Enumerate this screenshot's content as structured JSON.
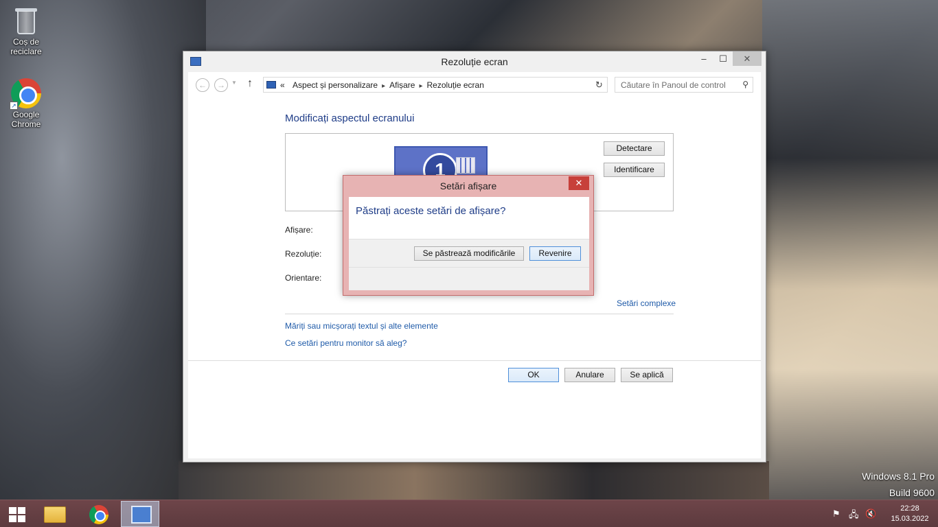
{
  "desktop": {
    "icons": [
      {
        "label": "Coș de reciclare",
        "icon": "recycle-bin-icon"
      },
      {
        "label": "Google Chrome",
        "icon": "chrome-icon"
      }
    ]
  },
  "window": {
    "title": "Rezoluție ecran",
    "controls": {
      "minimize": "–",
      "maximize": "☐",
      "close": "✕"
    },
    "address": {
      "prefix": "«",
      "crumbs": [
        "Aspect și personalizare",
        "Afișare",
        "Rezoluție ecran"
      ],
      "separator": "▸"
    },
    "search_placeholder": "Căutare în Panoul de control",
    "heading": "Modificați aspectul ecranului",
    "monitor_number": "1",
    "buttons": {
      "detect": "Detectare",
      "identify": "Identificare",
      "ok": "OK",
      "cancel": "Anulare",
      "apply": "Se aplică"
    },
    "fields": {
      "display": "Afișare:",
      "resolution": "Rezoluție:",
      "orientation": "Orientare:"
    },
    "links": {
      "advanced": "Setări complexe",
      "text_size": "Măriți sau micșorați textul și alte elemente",
      "which_settings": "Ce setări pentru monitor să aleg?"
    }
  },
  "dialog": {
    "title": "Setări afișare",
    "close": "✕",
    "question": "Păstrați aceste setări de afișare?",
    "keep_button": "Se păstrează modificările",
    "revert_button": "Revenire"
  },
  "watermark": {
    "line1": "Windows 8.1 Pro",
    "line2": "Build 9600"
  },
  "taskbar": {
    "time": "22:28",
    "date": "15.03.2022",
    "items": [
      "start-icon",
      "file-explorer-icon",
      "chrome-icon",
      "control-panel-icon"
    ]
  },
  "colors": {
    "link": "#1e5aa8",
    "heading": "#1e3c87",
    "taskbar": "#5c3a3e",
    "dialog_frame": "#e7b3b3"
  }
}
